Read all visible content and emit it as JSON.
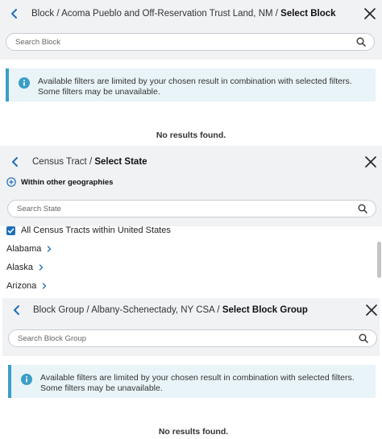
{
  "panel1": {
    "crumb_prefix": "Block / Acoma Pueblo and Off-Reservation Trust Land, NM / ",
    "crumb_current": "Select Block",
    "search_placeholder": "Search Block",
    "info_line1": "Available filters are limited by your chosen result in combination with selected filters.",
    "info_line2": "Some filters may be unavailable.",
    "no_results": "No results found."
  },
  "panel2": {
    "crumb_prefix": "Census Tract / ",
    "crumb_current": "Select State",
    "within_label": "Within other geographies",
    "search_placeholder": "Search State",
    "all_label": "All Census Tracts within United States",
    "states": [
      "Alabama",
      "Alaska",
      "Arizona"
    ]
  },
  "panel3": {
    "crumb_prefix": "Block Group / Albany-Schenectady, NY CSA / ",
    "crumb_current": "Select Block Group",
    "search_placeholder": "Search Block Group",
    "info_line1": "Available filters are limited by your chosen result in combination with selected filters.",
    "info_line2": "Some filters may be unavailable.",
    "no_results": "No results found."
  },
  "colors": {
    "accent": "#1f6fb8",
    "info_bg": "#e9f4f8",
    "info_border": "#3a9ec7",
    "panel_bg": "#f1f2f4"
  },
  "icons": [
    "back-arrow-icon",
    "close-icon",
    "search-icon",
    "info-icon",
    "plus-circle-icon",
    "checkmark-icon",
    "chevron-right-icon"
  ]
}
